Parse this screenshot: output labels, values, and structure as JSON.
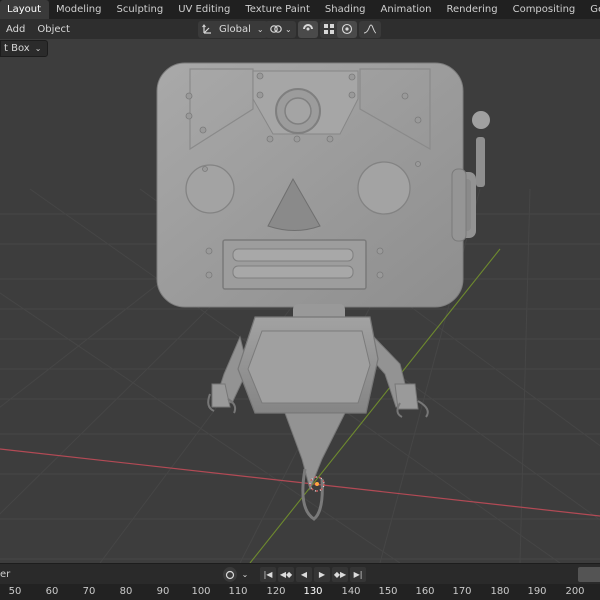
{
  "workspace_tabs": [
    "Layout",
    "Modeling",
    "Sculpting",
    "UV Editing",
    "Texture Paint",
    "Shading",
    "Animation",
    "Rendering",
    "Compositing",
    "Geometry Nodes"
  ],
  "active_tab": "Layout",
  "header_menu": {
    "add": "Add",
    "object": "Object"
  },
  "transform": {
    "orientation": "Global"
  },
  "tool_dropdown": {
    "label": "t Box"
  },
  "timeline": {
    "left_label": "er"
  },
  "ruler_ticks": [
    "50",
    "60",
    "70",
    "80",
    "90",
    "100",
    "110",
    "120",
    "130",
    "140",
    "150",
    "160",
    "170",
    "180",
    "190",
    "200"
  ],
  "current_frame_tick": "130",
  "colors": {
    "x_axis": "#b34a55",
    "y_axis": "#6e8a2e",
    "background": "#3d3d3d",
    "model": "#9a9a9a"
  }
}
